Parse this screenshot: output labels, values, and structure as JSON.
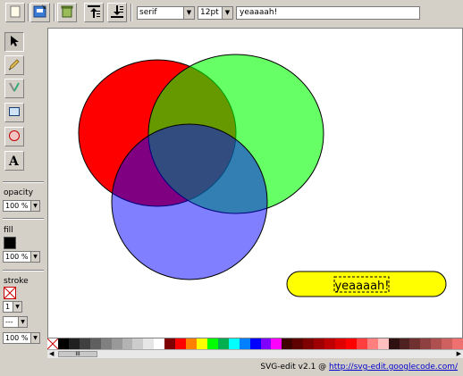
{
  "toolbar": {
    "font_family": "serif",
    "font_size": "12pt",
    "text_value": "yeaaaah!"
  },
  "left_panel": {
    "opacity_label": "opacity",
    "opacity_value": "100 %",
    "fill_label": "fill",
    "fill_color": "#000000",
    "fill_opacity_value": "100 %",
    "stroke_label": "stroke",
    "stroke_width_value": "1",
    "stroke_dash_value": "---",
    "stroke_opacity_value": "100 %"
  },
  "canvas": {
    "circles": [
      {
        "name": "red-ellipse",
        "fill": "#ff0000"
      },
      {
        "name": "green-ellipse",
        "fill": "#00ff00"
      },
      {
        "name": "blue-ellipse",
        "fill": "#0000ff"
      }
    ],
    "text_element": "yeaaaah!",
    "text_bg_color": "#ffff00"
  },
  "palette": {
    "colors": [
      "#000000",
      "#202020",
      "#404040",
      "#606060",
      "#808080",
      "#999999",
      "#b3b3b3",
      "#cccccc",
      "#e6e6e6",
      "#ffffff",
      "#7f0000",
      "#ff0000",
      "#ff7f00",
      "#ffff00",
      "#00ff00",
      "#00b050",
      "#00ffff",
      "#007fff",
      "#0000ff",
      "#7f00ff",
      "#ff00ff",
      "#3f0000",
      "#5f0000",
      "#7f0000",
      "#9f0000",
      "#bf0000",
      "#df0000",
      "#ff0000",
      "#ff3f3f",
      "#ff7f7f",
      "#ffbfbf",
      "#2f1010",
      "#4f2020",
      "#6f3030",
      "#8f4040",
      "#af5050",
      "#cf6060",
      "#ef7070"
    ]
  },
  "hscroll": {
    "thumb_label": "III"
  },
  "footer": {
    "prefix": "SVG-edit v2.1 @ ",
    "link": "http://svg-edit.googlecode.com/"
  }
}
